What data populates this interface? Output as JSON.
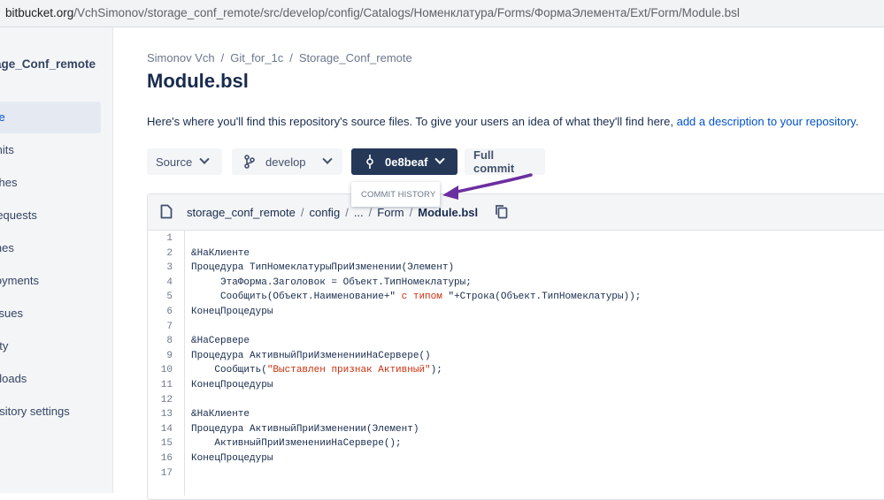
{
  "browser": {
    "url_host": "bitbucket.org",
    "url_path": "/VchSimonov/storage_conf_remote/src/develop/config/Catalogs/Номенклатура/Forms/ФормаЭлемента/Ext/Form/Module.bsl"
  },
  "sidebar": {
    "repo_name": "age_Conf_remote",
    "items": [
      {
        "label": "ce"
      },
      {
        "label": "mits"
      },
      {
        "label": "ches"
      },
      {
        "label": "requests"
      },
      {
        "label": "ines"
      },
      {
        "label": "loyments"
      },
      {
        "label": "ssues"
      },
      {
        "label": "rity"
      },
      {
        "label": "nloads"
      },
      {
        "label": "ository settings"
      }
    ]
  },
  "breadcrumb": [
    "Simonov Vch",
    "Git_for_1c",
    "Storage_Conf_remote"
  ],
  "page_title": "Module.bsl",
  "description": {
    "text": "Here's where you'll find this repository's source files. To give your users an idea of what they'll find here, ",
    "link": "add a description to your repository",
    "end": "."
  },
  "toolbar": {
    "source_label": "Source",
    "branch_label": "develop",
    "commit_label": "0e8beaf",
    "full_commit_label": "Full commit"
  },
  "popup": {
    "label": "COMMIT HISTORY"
  },
  "file": {
    "path": [
      "storage_conf_remote",
      "config",
      "...",
      "Form"
    ],
    "filename": "Module.bsl",
    "lines": [
      {
        "n": "1",
        "text": ""
      },
      {
        "n": "2",
        "text": "&НаКлиенте"
      },
      {
        "n": "3",
        "text": "Процедура ТипНомеклатурыПриИзменении(Элемент)"
      },
      {
        "n": "4",
        "text": "     ЭтаФорма.Заголовок = Объект.ТипНомеклатуры;"
      },
      {
        "n": "5",
        "pre": "     Сообщить(Объект.Наименование+\"",
        "str": " с типом ",
        "post": "\"+Строка(Объект.ТипНомеклатуры));"
      },
      {
        "n": "6",
        "text": "КонецПроцедуры"
      },
      {
        "n": "7",
        "text": ""
      },
      {
        "n": "8",
        "text": "&НаСервере"
      },
      {
        "n": "9",
        "text": "Процедура АктивныйПриИзмененииНаСервере()"
      },
      {
        "n": "10",
        "pre": "    Сообщить(",
        "str": "\"Выставлен признак Активный\"",
        "post": ");"
      },
      {
        "n": "11",
        "text": "КонецПроцедуры"
      },
      {
        "n": "12",
        "text": ""
      },
      {
        "n": "13",
        "text": "&НаКлиенте"
      },
      {
        "n": "14",
        "text": "Процедура АктивныйПриИзменении(Элемент)"
      },
      {
        "n": "15",
        "text": "    АктивныйПриИзмененииНаСервере();"
      },
      {
        "n": "16",
        "text": "КонецПроцедуры"
      },
      {
        "n": "17",
        "text": ""
      }
    ]
  },
  "colors": {
    "accent": "#0052cc",
    "dark_button": "#253858",
    "annotation_arrow": "#6b2fa0",
    "string": "#c9300d"
  }
}
